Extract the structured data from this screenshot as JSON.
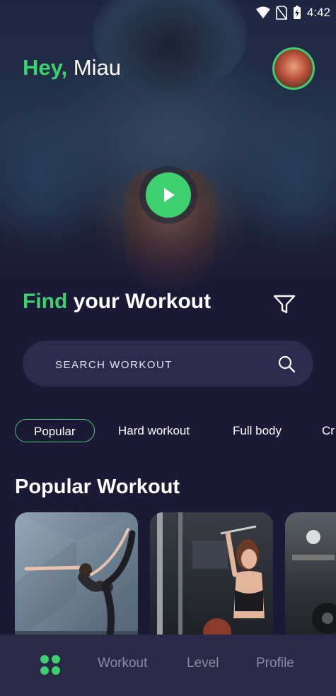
{
  "status": {
    "time": "4:42"
  },
  "header": {
    "greeting_prefix": "Hey,",
    "user_name": "Miau"
  },
  "hero": {
    "play_label": "Play intro video"
  },
  "find": {
    "accent": "Find",
    "rest": "your Workout"
  },
  "search": {
    "placeholder": "SEARCH WORKOUT",
    "value": ""
  },
  "categories": [
    {
      "label": "Popular",
      "active": true
    },
    {
      "label": "Hard workout",
      "active": false
    },
    {
      "label": "Full body",
      "active": false
    },
    {
      "label": "Cr",
      "active": false
    }
  ],
  "popular": {
    "title": "Popular Workout",
    "cards": [
      {
        "image": "yoga-balance-pose"
      },
      {
        "image": "gym-cable-pulldown"
      },
      {
        "image": "gym-interior"
      }
    ]
  },
  "nav": {
    "items": [
      {
        "icon": "grid-home-icon",
        "label": "",
        "active": true
      },
      {
        "label": "Workout",
        "active": false
      },
      {
        "label": "Level",
        "active": false
      },
      {
        "label": "Profile",
        "active": false
      }
    ]
  },
  "colors": {
    "accent": "#3ecf6e",
    "background": "#1b1936",
    "surface": "#2c2b4e",
    "nav": "#2a2947",
    "muted": "#8d8ca6"
  }
}
